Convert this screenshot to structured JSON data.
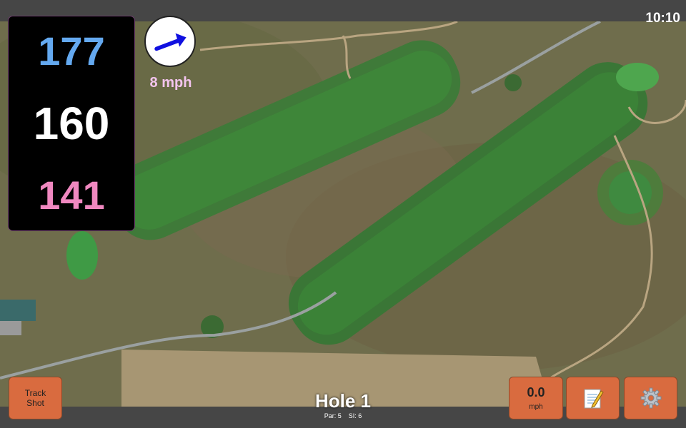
{
  "status": {
    "time": "10:10"
  },
  "yardage": {
    "back": "177",
    "center": "160",
    "front": "141"
  },
  "wind": {
    "speed_label": "8 mph",
    "icon": "wind-direction-arrow-icon"
  },
  "controls": {
    "track_shot_label_line1": "Track",
    "track_shot_label_line2": "Shot",
    "speed_value": "0.0",
    "speed_unit": "mph",
    "notes_icon": "notepad-icon",
    "settings_icon": "gear-icon"
  },
  "hole": {
    "title": "Hole 1",
    "par_label": "Par: 5",
    "si_label": "SI: 6"
  },
  "colors": {
    "back": "#64a9f0",
    "center": "#ffffff",
    "front": "#f088c0",
    "wind_text": "#f3c4ee",
    "wind_arrow": "#1010e0",
    "button_bg": "#d96b3f",
    "bar_bg": "#464646",
    "yardage_bg": "#000000"
  }
}
